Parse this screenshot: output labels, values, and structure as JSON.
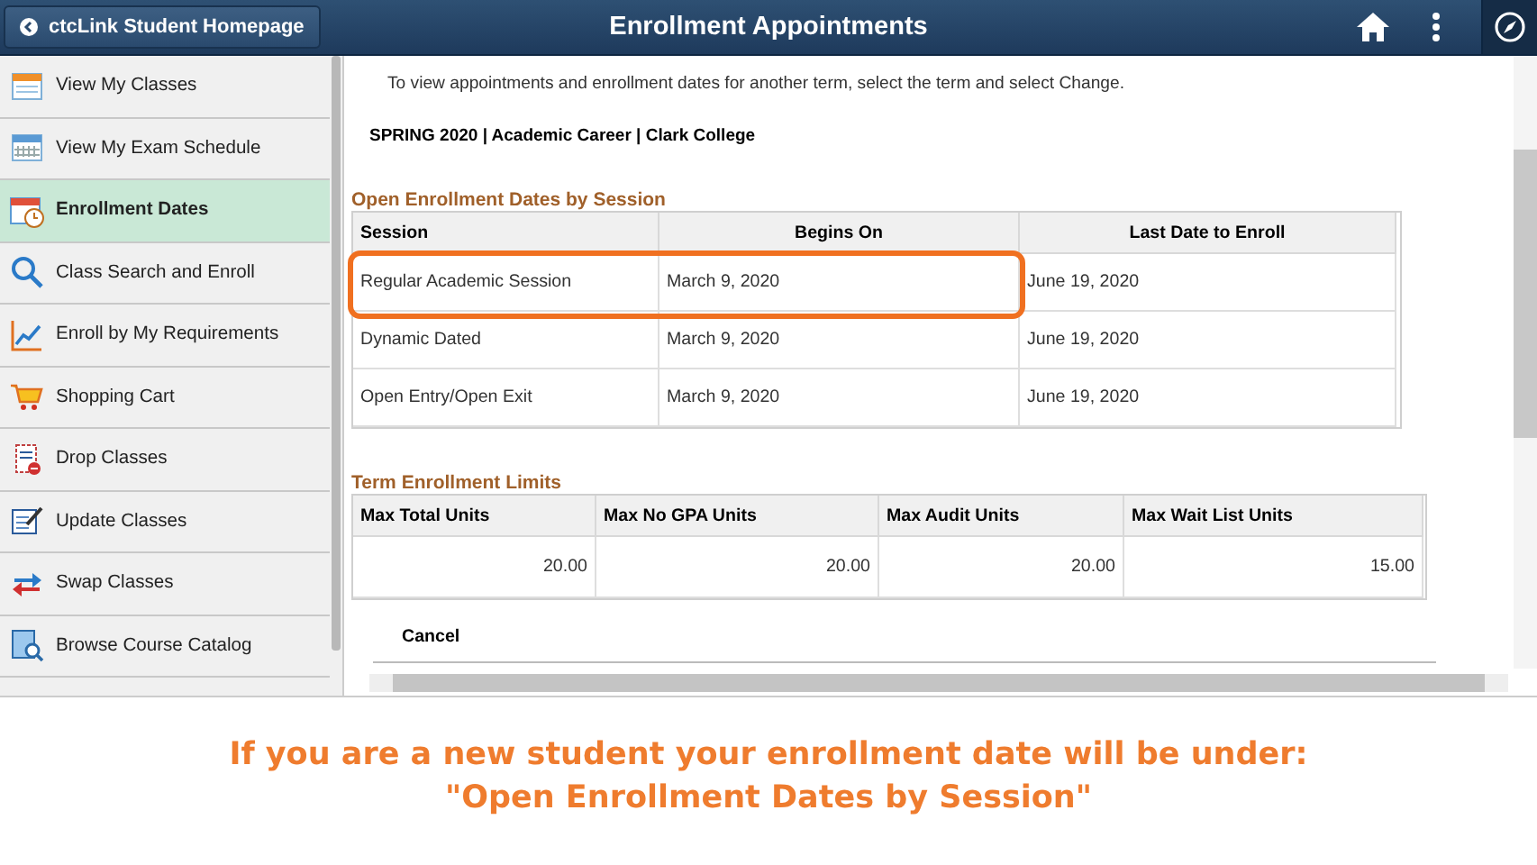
{
  "header": {
    "back_button": "ctcLink Student Homepage",
    "title": "Enrollment Appointments"
  },
  "sidebar": {
    "items": [
      {
        "label": "View My Classes",
        "selected": false
      },
      {
        "label": "View My Exam Schedule",
        "selected": false
      },
      {
        "label": "Enrollment Dates",
        "selected": true
      },
      {
        "label": "Class Search and Enroll",
        "selected": false
      },
      {
        "label": "Enroll by My Requirements",
        "selected": false
      },
      {
        "label": "Shopping Cart",
        "selected": false
      },
      {
        "label": "Drop Classes",
        "selected": false
      },
      {
        "label": "Update Classes",
        "selected": false
      },
      {
        "label": "Swap Classes",
        "selected": false
      },
      {
        "label": "Browse Course Catalog",
        "selected": false
      }
    ]
  },
  "content": {
    "intro": "To view appointments and enrollment dates for another term, select the term and select Change.",
    "term": "SPRING 2020 | Academic Career | Clark College",
    "sessions": {
      "title": "Open Enrollment Dates by Session",
      "columns": [
        "Session",
        "Begins On",
        "Last Date to Enroll"
      ],
      "rows": [
        {
          "cells": [
            "Regular Academic Session",
            "March 9, 2020",
            "June 19, 2020"
          ],
          "highlighted": true
        },
        {
          "cells": [
            "Dynamic Dated",
            "March 9, 2020",
            "June 19, 2020"
          ],
          "highlighted": false
        },
        {
          "cells": [
            "Open Entry/Open Exit",
            "March 9, 2020",
            "June 19, 2020"
          ],
          "highlighted": false
        }
      ]
    },
    "limits": {
      "title": "Term Enrollment Limits",
      "columns": [
        "Max Total Units",
        "Max No GPA Units",
        "Max Audit Units",
        "Max Wait List Units"
      ],
      "rows": [
        [
          "20.00",
          "20.00",
          "20.00",
          "15.00"
        ]
      ]
    },
    "cancel": "Cancel"
  },
  "caption": [
    "If you are a new student your enrollment date will be under:",
    "\"Open Enrollment Dates by Session\""
  ]
}
